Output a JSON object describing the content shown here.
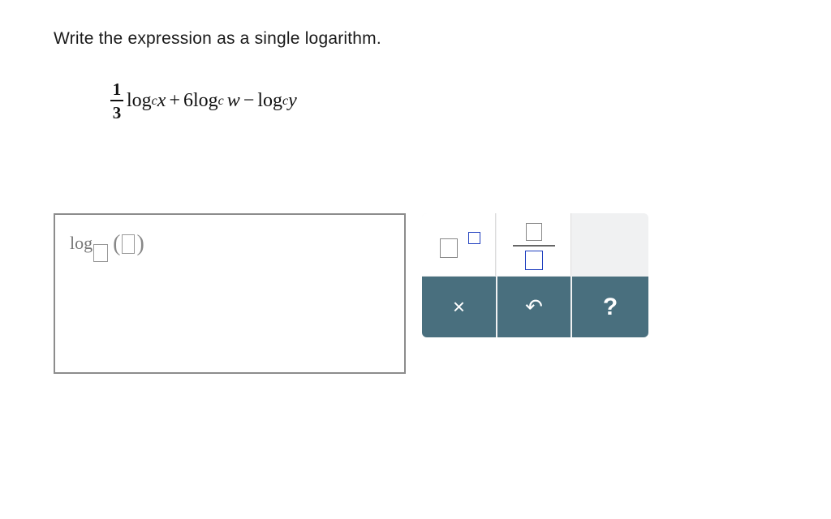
{
  "question": {
    "prompt": "Write the expression as a single logarithm.",
    "expression": {
      "coef_num": "1",
      "coef_den": "3",
      "term1_fn": "log",
      "term1_base": "c",
      "term1_arg": "x",
      "op1": "+",
      "term2_coef": "6",
      "term2_fn": "log",
      "term2_base": "c",
      "term2_arg": "w",
      "op2": "−",
      "term3_fn": "log",
      "term3_base": "c",
      "term3_arg": "y"
    }
  },
  "answer": {
    "template_fn": "log",
    "open_paren": "(",
    "close_paren": ")"
  },
  "keypad": {
    "clear_glyph": "×",
    "undo_glyph": "↶",
    "help_glyph": "?",
    "colors": {
      "bottom_bar": "#496f7e",
      "active_slot": "#1f3fbf"
    },
    "icons": [
      "superscript-icon",
      "fraction-icon",
      "clear-icon",
      "undo-icon",
      "help-icon"
    ]
  }
}
